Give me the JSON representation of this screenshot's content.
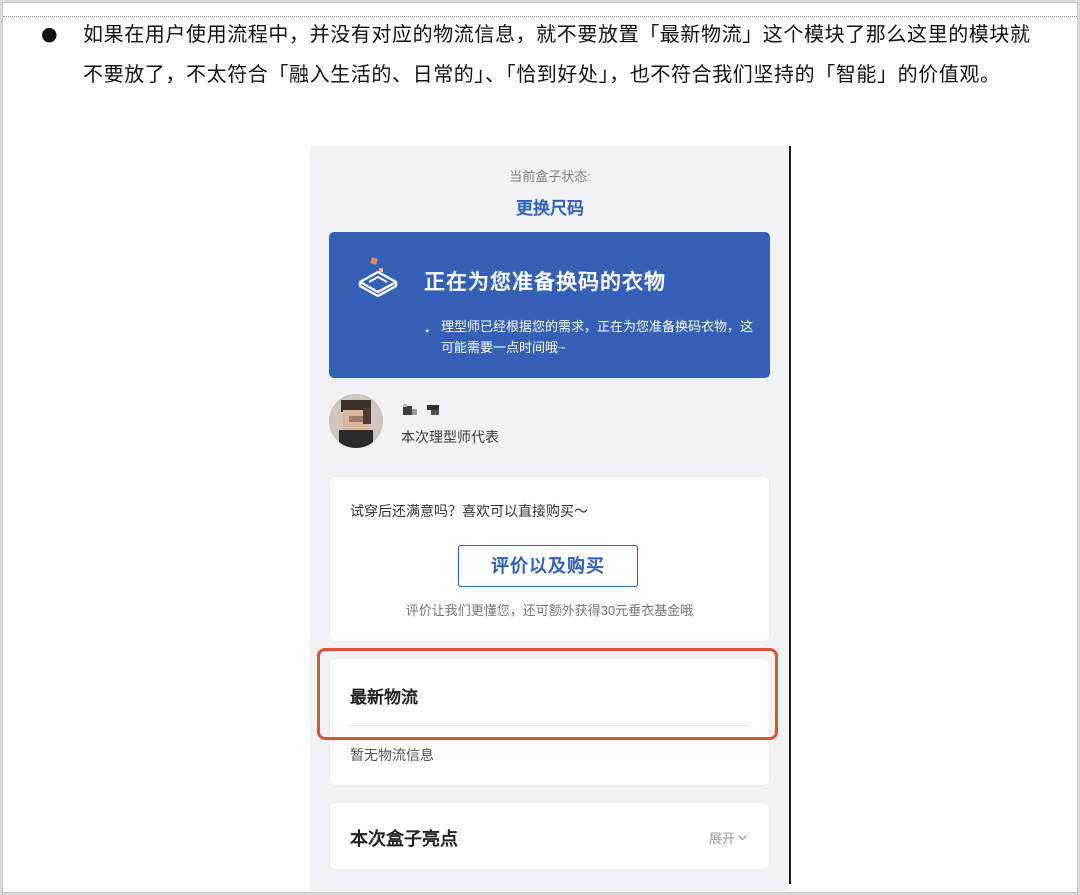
{
  "paragraph": {
    "bullet": "●",
    "text": "如果在用户使用流程中，并没有对应的物流信息，就不要放置「最新物流」这个模块了那么这里的模块就不要放了，不太符合「融入生活的、日常的」、「恰到好处」，也不符合我们坚持的「智能」的价值观。"
  },
  "screen": {
    "status_label": "当前盒子状态:",
    "status_value": "更换尺码",
    "banner": {
      "icon": "box-icon",
      "title": "正在为您准备换码的衣物",
      "bullet": "•",
      "description": "理型师已经根据您的需求，正在为您准备换码衣物，这可能需要一点时间哦~",
      "color": "#3560b8"
    },
    "stylist": {
      "avatar": "avatar",
      "role": "本次理型师代表"
    },
    "buy_card": {
      "prompt": "试穿后还满意吗？喜欢可以直接购买～",
      "button_label": "评价以及购买",
      "note": "评价让我们更懂您，还可额外获得30元垂衣基金哦"
    },
    "logistics": {
      "title": "最新物流",
      "empty_text": "暂无物流信息",
      "highlight_color": "#d8553a"
    },
    "highlights": {
      "title": "本次盒子亮点",
      "expand_label": "展开"
    },
    "accent_color": "#2f5fbd"
  }
}
